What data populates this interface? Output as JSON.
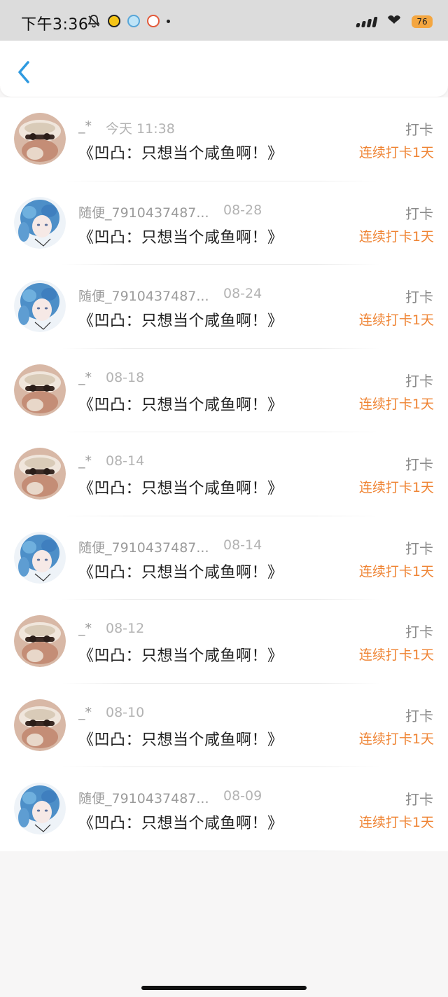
{
  "status_bar": {
    "time": "下午3:36",
    "battery": "76",
    "icons": [
      "bell-off-icon",
      "app-notification-icon",
      "app-notification-icon",
      "app-notification-icon",
      "more-dot-icon",
      "signal-icon",
      "wifi-icon",
      "battery-icon"
    ]
  },
  "header": {
    "back_icon": "chevron-left-icon"
  },
  "colors": {
    "streak": "#ef8434",
    "back": "#2f9ae0"
  },
  "items": [
    {
      "avatar": "avatar-character-a",
      "name": "_*",
      "time": "今天 11:38",
      "title": "《凹凸：只想当个咸鱼啊！》",
      "type": "打卡",
      "streak": "连续打卡1天"
    },
    {
      "avatar": "avatar-character-b",
      "name": "随便_7910437487...",
      "time": "08-28",
      "title": "《凹凸：只想当个咸鱼啊！》",
      "type": "打卡",
      "streak": "连续打卡1天"
    },
    {
      "avatar": "avatar-character-b",
      "name": "随便_7910437487...",
      "time": "08-24",
      "title": "《凹凸：只想当个咸鱼啊！》",
      "type": "打卡",
      "streak": "连续打卡1天"
    },
    {
      "avatar": "avatar-character-a",
      "name": "_*",
      "time": "08-18",
      "title": "《凹凸：只想当个咸鱼啊！》",
      "type": "打卡",
      "streak": "连续打卡1天"
    },
    {
      "avatar": "avatar-character-a",
      "name": "_*",
      "time": "08-14",
      "title": "《凹凸：只想当个咸鱼啊！》",
      "type": "打卡",
      "streak": "连续打卡1天"
    },
    {
      "avatar": "avatar-character-b",
      "name": "随便_7910437487...",
      "time": "08-14",
      "title": "《凹凸：只想当个咸鱼啊！》",
      "type": "打卡",
      "streak": "连续打卡1天"
    },
    {
      "avatar": "avatar-character-a",
      "name": "_*",
      "time": "08-12",
      "title": "《凹凸：只想当个咸鱼啊！》",
      "type": "打卡",
      "streak": "连续打卡1天"
    },
    {
      "avatar": "avatar-character-a",
      "name": "_*",
      "time": "08-10",
      "title": "《凹凸：只想当个咸鱼啊！》",
      "type": "打卡",
      "streak": "连续打卡1天"
    },
    {
      "avatar": "avatar-character-b",
      "name": "随便_7910437487...",
      "time": "08-09",
      "title": "《凹凸：只想当个咸鱼啊！》",
      "type": "打卡",
      "streak": "连续打卡1天"
    }
  ]
}
